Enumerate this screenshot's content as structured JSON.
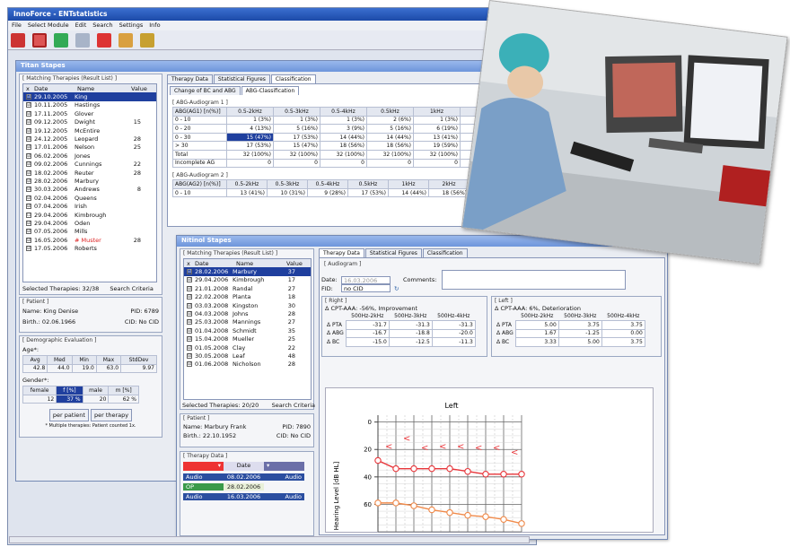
{
  "app": {
    "title": "InnoForce - ENTstatistics",
    "menu": [
      "File",
      "Select Module",
      "Edit",
      "Search",
      "Settings",
      "Info"
    ]
  },
  "titan": {
    "title": "Titan Stapes",
    "group": "[ Matching Therapies (Result List) ]",
    "cols": [
      "x",
      "Date",
      "Name",
      "Value"
    ],
    "rows": [
      {
        "c": "☑",
        "date": "29.10.2005",
        "name": "King",
        "value": "",
        "sel": true
      },
      {
        "c": "☑",
        "date": "10.11.2005",
        "name": "Hastings",
        "value": ""
      },
      {
        "c": "☑",
        "date": "17.11.2005",
        "name": "Glover",
        "value": ""
      },
      {
        "c": "☑",
        "date": "09.12.2005",
        "name": "Dwight",
        "value": "15"
      },
      {
        "c": "☑",
        "date": "19.12.2005",
        "name": "McEntire",
        "value": ""
      },
      {
        "c": "☑",
        "date": "24.12.2005",
        "name": "Leopard",
        "value": "28"
      },
      {
        "c": "☑",
        "date": "17.01.2006",
        "name": "Nelson",
        "value": "25"
      },
      {
        "c": "☑",
        "date": "06.02.2006",
        "name": "Jones",
        "value": ""
      },
      {
        "c": "☑",
        "date": "09.02.2006",
        "name": "Cunnings",
        "value": "22"
      },
      {
        "c": "☑",
        "date": "18.02.2006",
        "name": "Reuter",
        "value": "28"
      },
      {
        "c": "☑",
        "date": "28.02.2006",
        "name": "Marbury",
        "value": ""
      },
      {
        "c": "☑",
        "date": "30.03.2006",
        "name": "Andrews",
        "value": "8"
      },
      {
        "c": "☑",
        "date": "02.04.2006",
        "name": "Queens",
        "value": ""
      },
      {
        "c": "☑",
        "date": "07.04.2006",
        "name": "Irish",
        "value": ""
      },
      {
        "c": "☐",
        "date": "29.04.2006",
        "name": "Kimbrough",
        "value": ""
      },
      {
        "c": "☑",
        "date": "29.04.2006",
        "name": "Oden",
        "value": ""
      },
      {
        "c": "☑",
        "date": "07.05.2006",
        "name": "Mills",
        "value": ""
      },
      {
        "c": "☑",
        "date": "16.05.2006",
        "name": "# Muster",
        "value": "28",
        "red": true
      },
      {
        "c": "☑",
        "date": "17.05.2006",
        "name": "Roberts",
        "value": ""
      }
    ],
    "selected": "Selected Therapies: 32/38",
    "search": "Search Criteria",
    "patient": {
      "group": "[ Patient ]",
      "name": "Name: King Denise",
      "pid": "PID: 6789",
      "birth": "Birth.: 02.06.1966",
      "cid": "CID: No CID"
    },
    "demo": {
      "group": "[ Demographic Evaluation ]",
      "age": "Age*:",
      "age_cols": [
        "Avg",
        "Med",
        "Min",
        "Max",
        "StdDev"
      ],
      "age_vals": [
        "42.8",
        "44.0",
        "19.0",
        "63.0",
        "9.97"
      ],
      "gender": "Gender*:",
      "g_cols": [
        "female",
        "f [%]",
        "male",
        "m [%]"
      ],
      "g_vals": [
        "12",
        "37 %",
        "20",
        "62 %"
      ],
      "b1": "per patient",
      "b2": "per therapy",
      "note": "* Multiple therapies: Patient counted 1x."
    },
    "tabs": [
      "Therapy Data",
      "Statistical Figures",
      "Classification"
    ],
    "subtabs": [
      "Change of BC and ABG",
      "ABG-Classification"
    ],
    "ag1": {
      "group": "[ ABG-Audiogram 1 ]",
      "cols": [
        "ABG(AG1) [n(%)]",
        "0.5-2kHz",
        "0.5-3kHz",
        "0.5-4kHz",
        "0.5kHz",
        "1kHz",
        "2kHz",
        "3kHz"
      ],
      "rows": [
        [
          "0 - 10",
          "1 (3%)",
          "1 (3%)",
          "1 (3%)",
          "2 (6%)",
          "1 (3%)",
          "4 (13%)",
          "4 (13"
        ],
        [
          "0 - 20",
          "4 (13%)",
          "5 (16%)",
          "3 (9%)",
          "5 (16%)",
          "6 (19%)",
          "11 (34%)",
          "9 (2"
        ],
        [
          "0 - 30",
          "15 (47%)",
          "17 (53%)",
          "14 (44%)",
          "14 (44%)",
          "13 (41%)",
          "15 (47%)",
          "15 (4"
        ],
        [
          "> 30",
          "17 (53%)",
          "15 (47%)",
          "18 (56%)",
          "18 (56%)",
          "19 (59%)",
          "17 (53%)",
          "17 (53"
        ],
        [
          "Total",
          "32 (100%)",
          "32 (100%)",
          "32 (100%)",
          "32 (100%)",
          "32 (100%)",
          "32 (100%)",
          "32 (100"
        ],
        [
          "Incomplete AG",
          "0",
          "0",
          "0",
          "0",
          "0",
          "0",
          "0"
        ]
      ]
    },
    "ag2": {
      "group": "[ ABG-Audiogram 2 ]",
      "cols": [
        "ABG(AG2) [n(%)]",
        "0.5-2kHz",
        "0.5-3kHz",
        "0.5-4kHz",
        "0.5kHz",
        "1kHz",
        "2kHz",
        "3kHz",
        "4kHz"
      ],
      "rows": [
        [
          "0 - 10",
          "13 (41%)",
          "10 (31%)",
          "9 (28%)",
          "17 (53%)",
          "14 (44%)",
          "18 (56%)",
          "12 (38%)",
          "10 (31%)"
        ]
      ]
    }
  },
  "nitinol": {
    "title": "Nitinol Stapes",
    "group": "[ Matching Therapies (Result List) ]",
    "cols": [
      "x",
      "Date",
      "Name",
      "Value"
    ],
    "rows": [
      {
        "c": "☑",
        "date": "28.02.2006",
        "name": "Marbury",
        "value": "37",
        "sel": true
      },
      {
        "c": "☑",
        "date": "29.04.2006",
        "name": "Kimbrough",
        "value": "17"
      },
      {
        "c": "☑",
        "date": "21.01.2008",
        "name": "Randal",
        "value": "27"
      },
      {
        "c": "☑",
        "date": "22.02.2008",
        "name": "Planta",
        "value": "18"
      },
      {
        "c": "☑",
        "date": "03.03.2008",
        "name": "Kingston",
        "value": "30"
      },
      {
        "c": "☑",
        "date": "04.03.2008",
        "name": "Johns",
        "value": "28"
      },
      {
        "c": "☑",
        "date": "25.03.2008",
        "name": "Mannings",
        "value": "27"
      },
      {
        "c": "☑",
        "date": "01.04.2008",
        "name": "Schmidt",
        "value": "35"
      },
      {
        "c": "☑",
        "date": "15.04.2008",
        "name": "Mueller",
        "value": "25"
      },
      {
        "c": "☑",
        "date": "01.05.2008",
        "name": "Clay",
        "value": "22"
      },
      {
        "c": "☑",
        "date": "30.05.2008",
        "name": "Leaf",
        "value": "48"
      },
      {
        "c": "☑",
        "date": "01.06.2008",
        "name": "Nicholson",
        "value": "28"
      }
    ],
    "selected": "Selected Therapies: 20/20",
    "search": "Search Criteria",
    "patient": {
      "group": "[ Patient ]",
      "name": "Name: Marbury Frank",
      "pid": "PID: 7890",
      "birth": "Birth.: 22.10.1952",
      "cid": "CID: No CID"
    },
    "therapy": {
      "group": "[ Therapy Data ]",
      "head": "Date",
      "rows": [
        {
          "a": "Audio",
          "d": "08.02.2006",
          "b": "Audio"
        },
        {
          "a": "OP",
          "d": "28.02.2006",
          "b": ""
        },
        {
          "a": "Audio",
          "d": "16.03.2006",
          "b": "Audio"
        }
      ]
    },
    "tabs": [
      "Therapy Data",
      "Statistical Figures",
      "Classification"
    ],
    "audiogram": {
      "group": "[ Audiogram ]",
      "date_label": "Date:",
      "date_value": "16.03.2006",
      "comments": "Comments:",
      "fid_label": "FID:",
      "fid_value": "no CID"
    },
    "right": {
      "group": "[ Right ]",
      "title": "Δ CPT-AAA: -56%, Improvement",
      "cols": [
        "500Hz-2kHz",
        "500Hz-3kHz",
        "500Hz-4kHz"
      ],
      "rows": [
        [
          "Δ PTA",
          "-31.7",
          "-31.3",
          "-31.3"
        ],
        [
          "Δ ABG",
          "-16.7",
          "-18.8",
          "-20.0"
        ],
        [
          "Δ BC",
          "-15.0",
          "-12.5",
          "-11.3"
        ]
      ]
    },
    "left": {
      "group": "[ Left ]",
      "title": "Δ CPT-AAA: 6%, Deterioration",
      "cols": [
        "500Hz-2kHz",
        "500Hz-3kHz",
        "500Hz-4kHz"
      ],
      "rows": [
        [
          "Δ PTA",
          "5.00",
          "3.75",
          "3.75"
        ],
        [
          "Δ ABG",
          "1.67",
          "-1.25",
          "0.00"
        ],
        [
          "Δ BC",
          "3.33",
          "5.00",
          "3.75"
        ]
      ]
    }
  },
  "chart_data": {
    "type": "line",
    "title": "Left",
    "ylabel": "Hearing Level [dB HL]",
    "ylim": [
      -5,
      80
    ],
    "yticks": [
      0,
      20,
      40,
      60
    ],
    "colors": {
      "top": "#e8353a",
      "bottom": "#f08a4a"
    },
    "series": [
      {
        "values": [
          28,
          34,
          34,
          34,
          34,
          36,
          38,
          38,
          38
        ]
      },
      {
        "values": [
          59,
          59,
          61,
          64,
          66,
          68,
          69,
          71,
          74
        ]
      }
    ],
    "bc": [
      {
        "v": 18
      },
      {
        "v": 12
      },
      {
        "v": 19
      },
      {
        "v": 18
      },
      {
        "v": 18
      },
      {
        "v": 19
      },
      {
        "v": 19
      },
      {
        "v": 22
      }
    ]
  }
}
